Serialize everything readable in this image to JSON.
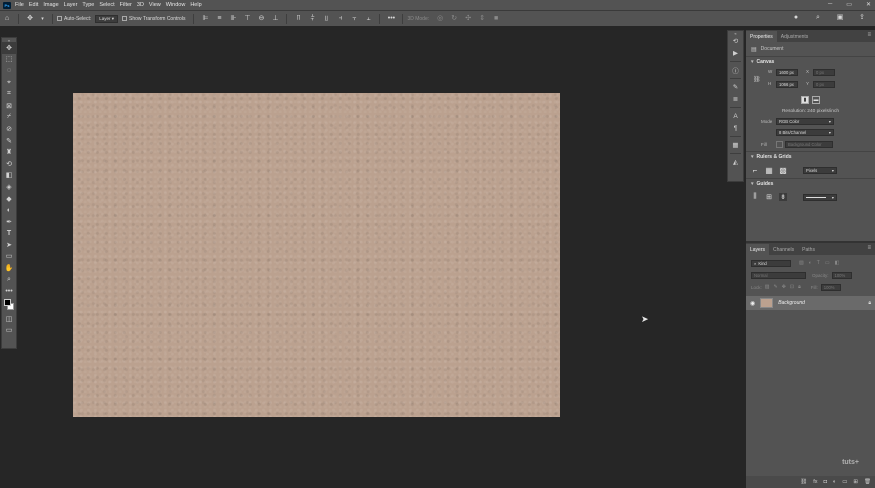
{
  "menubar": {
    "logo": "Ps",
    "items": [
      "File",
      "Edit",
      "Image",
      "Layer",
      "Type",
      "Select",
      "Filter",
      "3D",
      "View",
      "Window",
      "Help"
    ]
  },
  "options_bar": {
    "auto_select_label": "Auto-Select:",
    "auto_select_value": "Layer",
    "transform_label": "Show Transform Controls",
    "mode_3d_label": "3D Mode:"
  },
  "properties": {
    "tabs": [
      "Properties",
      "Adjustments"
    ],
    "doc_type": "Document",
    "canvas_section": "Canvas",
    "width_label": "W",
    "width_value": "1600 px",
    "height_label": "H",
    "height_value": "1066 px",
    "x_label": "X",
    "x_value": "0 px",
    "y_label": "Y",
    "y_value": "0 px",
    "resolution": "Resolution: 240 pixels/inch",
    "mode_label": "Mode",
    "mode_value": "RGB Color",
    "bits_value": "8 Bits/Channel",
    "fill_label": "Fill",
    "fill_value": "Background Color",
    "rulers_section": "Rulers & Grids",
    "units_value": "Pixels",
    "guides_section": "Guides"
  },
  "layers": {
    "tabs": [
      "Layers",
      "Channels",
      "Paths"
    ],
    "search_placeholder": "Kind",
    "blend_mode": "Normal",
    "opacity_label": "Opacity:",
    "opacity_value": "100%",
    "lock_label": "Lock:",
    "fill_label": "Fill:",
    "fill_value": "100%",
    "items": [
      {
        "name": "Background"
      }
    ]
  },
  "watermark": "tuts+",
  "colors": {
    "canvas_fill": "#bba18f",
    "workspace": "#262626",
    "panel": "#535353"
  }
}
